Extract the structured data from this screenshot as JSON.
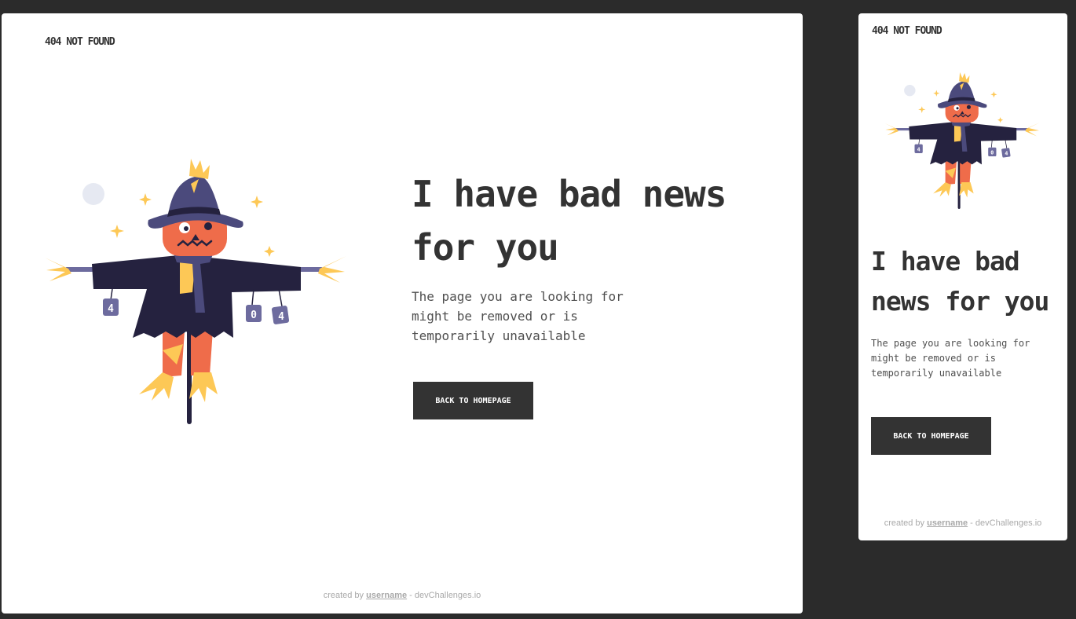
{
  "brand": "404 NOT FOUND",
  "headline": "I have bad news for you",
  "description": "The page you are looking for might be removed or is temporarily unavailable",
  "button_label": "BACK TO HOMEPAGE",
  "footer": {
    "prefix": "created by",
    "username": "username",
    "suffix": "- devChallenges.io"
  },
  "illustration": {
    "can_labels": [
      "4",
      "0",
      "4"
    ]
  },
  "colors": {
    "background": "#2b2b2b",
    "panel": "#ffffff",
    "text_dark": "#333333",
    "button_bg": "#333333",
    "hat": "#4b4a7c",
    "coat": "#25223f",
    "face": "#ef6c4a",
    "straw": "#fdc856",
    "moon": "#e6e9f2"
  }
}
